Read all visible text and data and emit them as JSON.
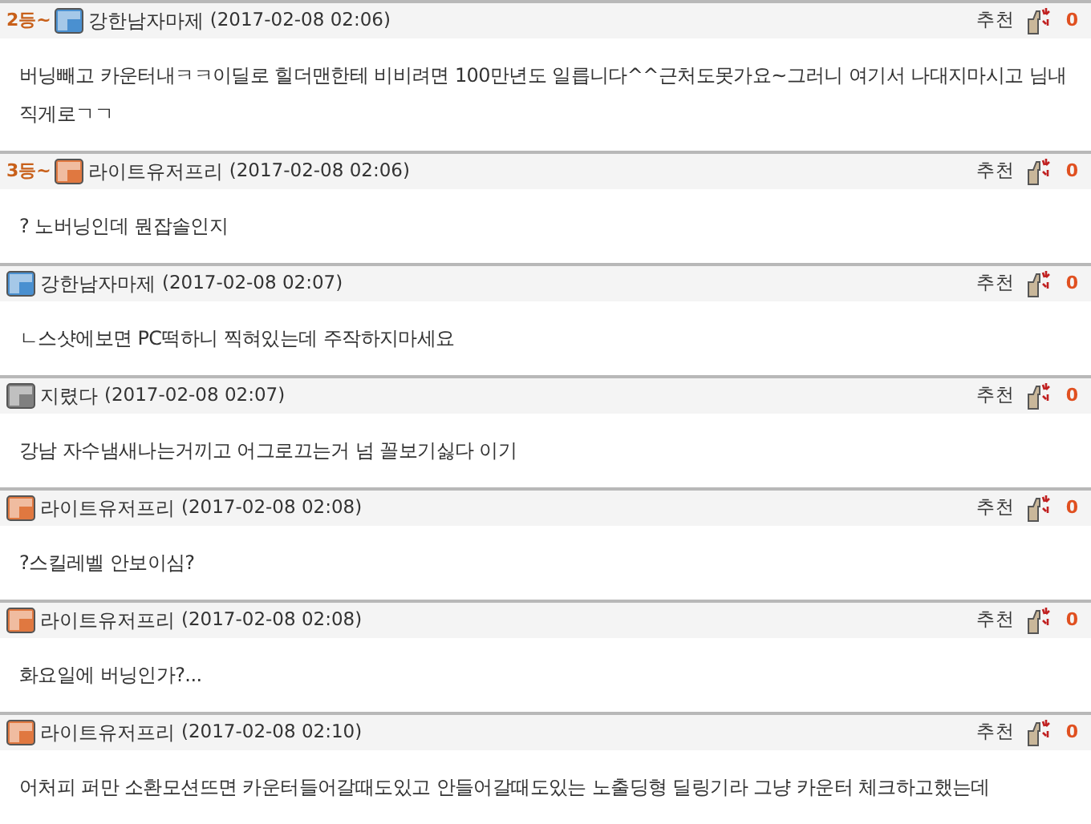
{
  "comments": [
    {
      "rank": "2등~",
      "color": "#4a90d0",
      "author": "강한남자마제",
      "time": "(2017-02-08 02:06)",
      "recommend_label": "추천",
      "votes": "0",
      "text": "버닝빼고 카운터내ㅋㅋ이딜로 힐더맨한테 비비려면 100만년도 일릅니다^^근처도못가요~그러니 여기서 나대지마시고 님내직게로ㄱㄱ"
    },
    {
      "rank": "3등~",
      "color": "#e07840",
      "author": "라이트유저프리",
      "time": "(2017-02-08 02:06)",
      "recommend_label": "추천",
      "votes": "0",
      "text": "? 노버닝인데 뭔잡솔인지"
    },
    {
      "color": "#4a90d0",
      "author": "강한남자마제",
      "time": "(2017-02-08 02:07)",
      "recommend_label": "추천",
      "votes": "0",
      "text": "ㄴ스샷에보면 PC떡하니 찍혀있는데 주작하지마세요"
    },
    {
      "color": "#808080",
      "author": "지렸다",
      "time": "(2017-02-08 02:07)",
      "recommend_label": "추천",
      "votes": "0",
      "text": "강남 자수냄새나는거끼고 어그로끄는거 넘 꼴보기싫다 이기"
    },
    {
      "color": "#e07840",
      "author": "라이트유저프리",
      "time": "(2017-02-08 02:08)",
      "recommend_label": "추천",
      "votes": "0",
      "text": "?스킬레벨 안보이심?"
    },
    {
      "color": "#e07840",
      "author": "라이트유저프리",
      "time": "(2017-02-08 02:08)",
      "recommend_label": "추천",
      "votes": "0",
      "text": "화요일에 버닝인가?..."
    },
    {
      "color": "#e07840",
      "author": "라이트유저프리",
      "time": "(2017-02-08 02:10)",
      "recommend_label": "추천",
      "votes": "0",
      "text": "어처피 퍼만 소환모션뜨면 카운터들어갈때도있고 안들어갈때도있는 노출딩형 딜링기라 그냥 카운터 체크하고했는데"
    }
  ]
}
